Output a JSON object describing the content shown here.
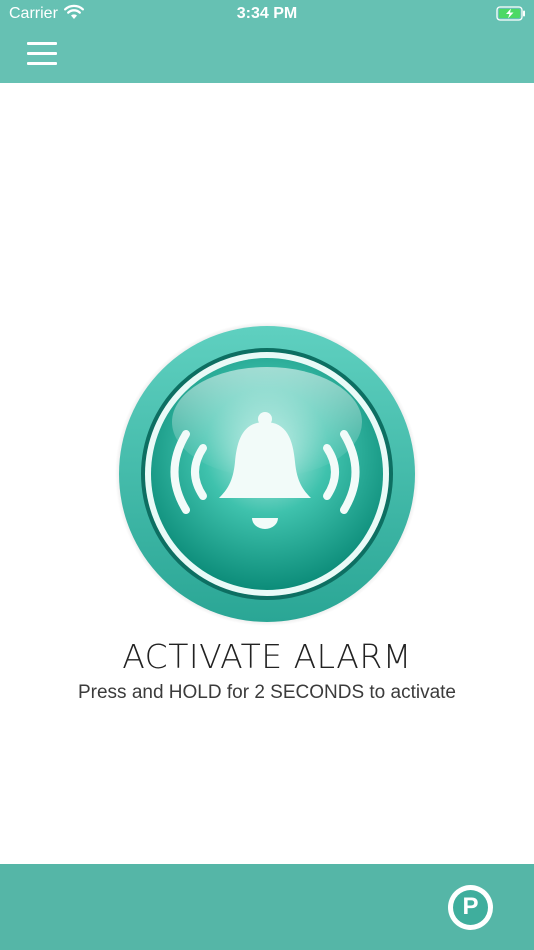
{
  "status_bar": {
    "carrier": "Carrier",
    "time": "3:34 PM",
    "wifi_icon": "wifi-icon",
    "battery_icon": "battery-charging-icon"
  },
  "header": {
    "menu_icon": "hamburger-menu-icon",
    "bar_color": "#66c1b3"
  },
  "main": {
    "alarm_icon": "bell-ringing-icon",
    "title": "ACTIVATE ALARM",
    "instruction": "Press and HOLD for 2 SECONDS to activate",
    "accent_color": "#2fb39f"
  },
  "footer": {
    "bar_color": "#55b6a7",
    "logo_letter": "P",
    "logo_icon": "p-logo-icon"
  }
}
